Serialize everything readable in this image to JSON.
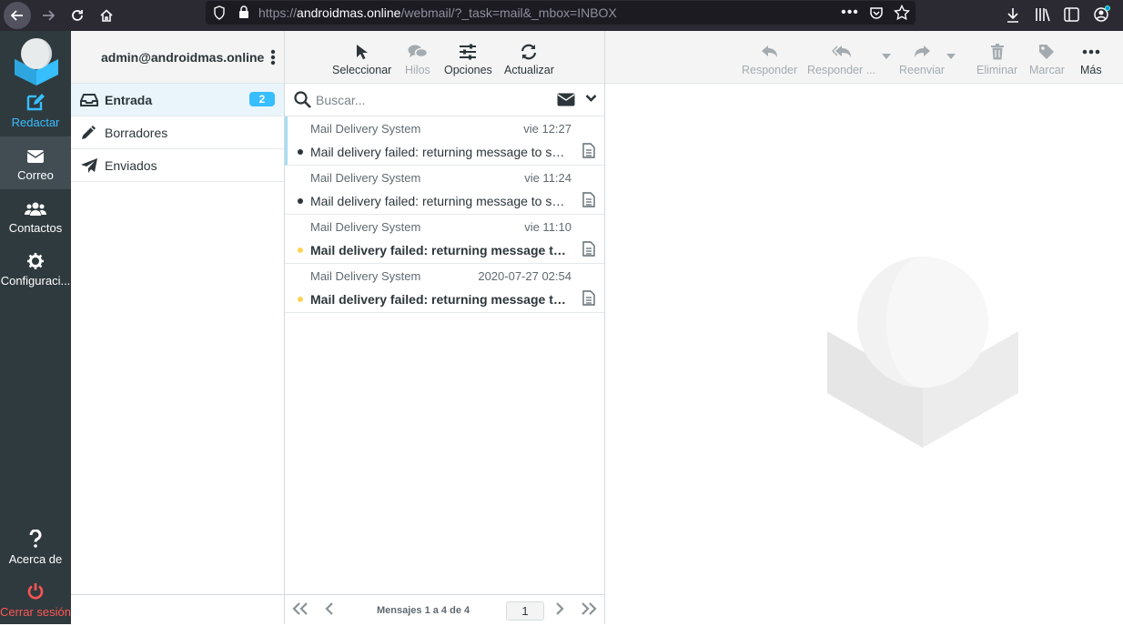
{
  "browser": {
    "url_scheme": "https://",
    "url_host": "androidmas.online",
    "url_path": "/webmail/?_task=mail&_mbox=INBOX"
  },
  "main_menu": {
    "items": [
      {
        "label": "Redactar",
        "icon": "compose-icon",
        "color": "#37beff"
      },
      {
        "label": "Correo",
        "icon": "envelope-icon"
      },
      {
        "label": "Contactos",
        "icon": "users-icon"
      },
      {
        "label": "Configuraci...",
        "icon": "gear-icon"
      }
    ],
    "about_label": "Acerca de",
    "logout_label": "Cerrar sesión",
    "logout_color": "#ff5552"
  },
  "folders": {
    "account": "admin@androidmas.online",
    "items": [
      {
        "name": "Entrada",
        "icon": "inbox-icon",
        "unread": "2",
        "selected": true
      },
      {
        "name": "Borradores",
        "icon": "pencil-icon"
      },
      {
        "name": "Enviados",
        "icon": "paper-plane-icon"
      }
    ]
  },
  "list_toolbar": {
    "select": "Seleccionar",
    "threads": "Hilos",
    "options": "Opciones",
    "refresh": "Actualizar"
  },
  "search": {
    "placeholder": "Buscar..."
  },
  "messages": [
    {
      "from": "Mail Delivery System",
      "date": "vie 12:27",
      "subject": "Mail delivery failed: returning message to sender",
      "unread": false
    },
    {
      "from": "Mail Delivery System",
      "date": "vie 11:24",
      "subject": "Mail delivery failed: returning message to sender",
      "unread": false
    },
    {
      "from": "Mail Delivery System",
      "date": "vie 11:10",
      "subject": "Mail delivery failed: returning message to sender",
      "unread": true
    },
    {
      "from": "Mail Delivery System",
      "date": "2020-07-27 02:54",
      "subject": "Mail delivery failed: returning message to sender",
      "unread": true
    }
  ],
  "pagination": {
    "count_text": "Mensajes 1 a 4 de 4",
    "page": "1"
  },
  "preview_toolbar": {
    "reply": "Responder",
    "reply_all": "Responder ...",
    "forward": "Reenviar",
    "delete": "Eliminar",
    "mark": "Marcar",
    "more": "Más"
  },
  "colors": {
    "accent": "#37beff",
    "sidebar": "#2f3a3f",
    "unread_dot": "#ffd452"
  }
}
